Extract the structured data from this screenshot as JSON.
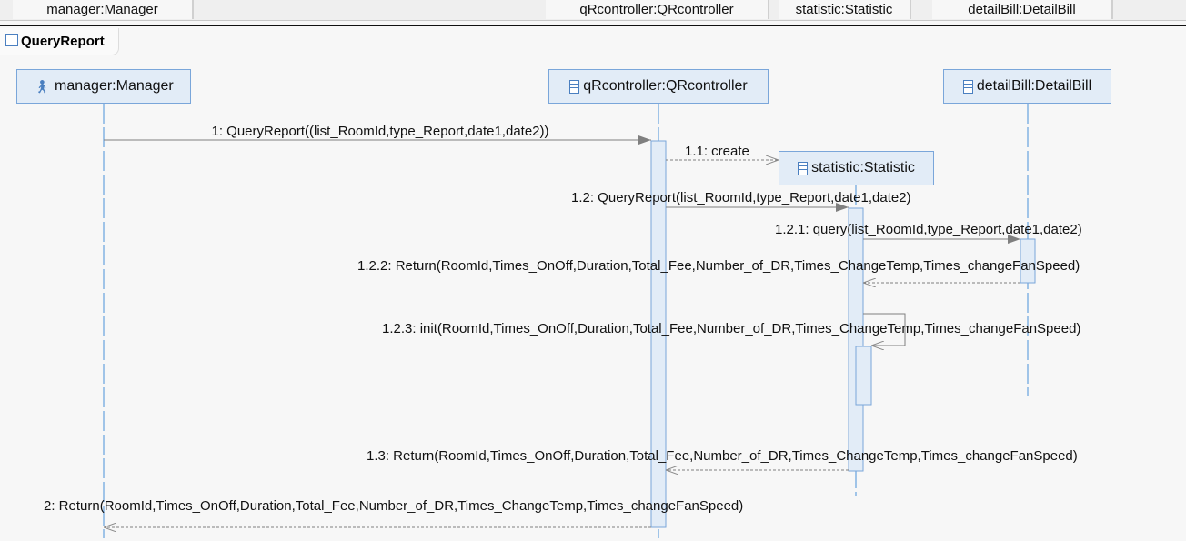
{
  "header_tabs": [
    "manager:Manager",
    "qRcontroller:QRcontroller",
    "statistic:Statistic",
    "detailBill:DetailBill"
  ],
  "frame": {
    "title": "QueryReport",
    "icon": "interaction-icon"
  },
  "lifelines": [
    {
      "name": "manager:Manager",
      "icon": "actor-icon"
    },
    {
      "name": "qRcontroller:QRcontroller",
      "icon": "class-icon"
    },
    {
      "name": "statistic:Statistic",
      "icon": "class-icon"
    },
    {
      "name": "detailBill:DetailBill",
      "icon": "class-icon"
    }
  ],
  "messages": [
    {
      "label": "1: QueryReport((list_RoomId,type_Report,date1,date2))",
      "kind": "sync"
    },
    {
      "label": "1.1: create",
      "kind": "create"
    },
    {
      "label": "1.2: QueryReport(list_RoomId,type_Report,date1,date2)",
      "kind": "sync"
    },
    {
      "label": "1.2.1: query(list_RoomId,type_Report,date1,date2)",
      "kind": "sync"
    },
    {
      "label": "1.2.2: Return(RoomId,Times_OnOff,Duration,Total_Fee,Number_of_DR,Times_ChangeTemp,Times_changeFanSpeed)",
      "kind": "reply"
    },
    {
      "label": "1.2.3: init(RoomId,Times_OnOff,Duration,Total_Fee,Number_of_DR,Times_ChangeTemp,Times_changeFanSpeed)",
      "kind": "self"
    },
    {
      "label": "1.3: Return(RoomId,Times_OnOff,Duration,Total_Fee,Number_of_DR,Times_ChangeTemp,Times_changeFanSpeed)",
      "kind": "reply"
    },
    {
      "label": "2: Return(RoomId,Times_OnOff,Duration,Total_Fee,Number_of_DR,Times_ChangeTemp,Times_changeFanSpeed)",
      "kind": "reply"
    }
  ],
  "colors": {
    "lifeline": "#4a90d9",
    "box_fill": "#e2ecf7",
    "box_border": "#7aa6da",
    "arrow": "#7f7f7f"
  }
}
